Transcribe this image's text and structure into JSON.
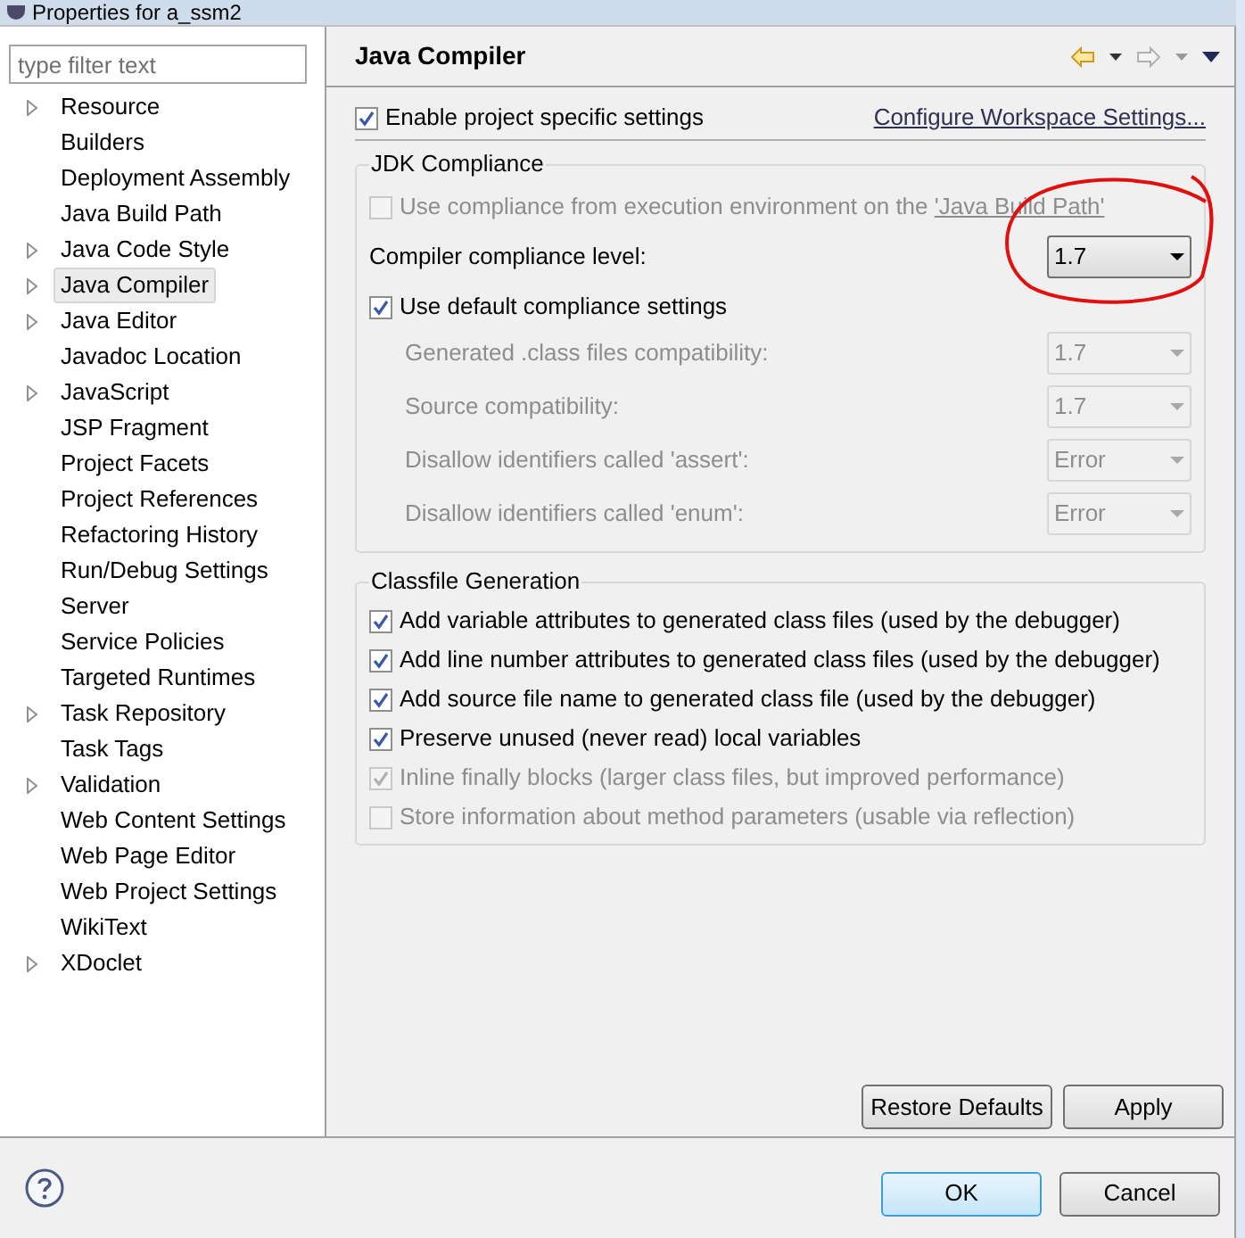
{
  "window": {
    "title": "Properties for a_ssm2"
  },
  "sidebar": {
    "filter": {
      "placeholder": "type filter text"
    },
    "items": [
      {
        "label": "Resource",
        "expandable": true,
        "selected": false
      },
      {
        "label": "Builders",
        "expandable": false,
        "selected": false
      },
      {
        "label": "Deployment Assembly",
        "expandable": false,
        "selected": false
      },
      {
        "label": "Java Build Path",
        "expandable": false,
        "selected": false
      },
      {
        "label": "Java Code Style",
        "expandable": true,
        "selected": false
      },
      {
        "label": "Java Compiler",
        "expandable": true,
        "selected": true
      },
      {
        "label": "Java Editor",
        "expandable": true,
        "selected": false
      },
      {
        "label": "Javadoc Location",
        "expandable": false,
        "selected": false
      },
      {
        "label": "JavaScript",
        "expandable": true,
        "selected": false
      },
      {
        "label": "JSP Fragment",
        "expandable": false,
        "selected": false
      },
      {
        "label": "Project Facets",
        "expandable": false,
        "selected": false
      },
      {
        "label": "Project References",
        "expandable": false,
        "selected": false
      },
      {
        "label": "Refactoring History",
        "expandable": false,
        "selected": false
      },
      {
        "label": "Run/Debug Settings",
        "expandable": false,
        "selected": false
      },
      {
        "label": "Server",
        "expandable": false,
        "selected": false
      },
      {
        "label": "Service Policies",
        "expandable": false,
        "selected": false
      },
      {
        "label": "Targeted Runtimes",
        "expandable": false,
        "selected": false
      },
      {
        "label": "Task Repository",
        "expandable": true,
        "selected": false
      },
      {
        "label": "Task Tags",
        "expandable": false,
        "selected": false
      },
      {
        "label": "Validation",
        "expandable": true,
        "selected": false
      },
      {
        "label": "Web Content Settings",
        "expandable": false,
        "selected": false
      },
      {
        "label": "Web Page Editor",
        "expandable": false,
        "selected": false
      },
      {
        "label": "Web Project Settings",
        "expandable": false,
        "selected": false
      },
      {
        "label": "WikiText",
        "expandable": false,
        "selected": false
      },
      {
        "label": "XDoclet",
        "expandable": true,
        "selected": false
      }
    ]
  },
  "page": {
    "title": "Java Compiler",
    "enable_specific": {
      "label": "Enable project specific settings",
      "checked": true
    },
    "configure_link": "Configure Workspace Settings...",
    "jdk_compliance": {
      "title": "JDK Compliance",
      "use_ee": {
        "label": "Use compliance from execution environment on the ",
        "link": "'Java Build Path'",
        "checked": false,
        "disabled": true
      },
      "compliance_level": {
        "label": "Compiler compliance level:",
        "value": "1.7"
      },
      "use_default": {
        "label": "Use default compliance settings",
        "checked": true
      },
      "settings": [
        {
          "label": "Generated .class files compatibility:",
          "value": "1.7",
          "disabled": true
        },
        {
          "label": "Source compatibility:",
          "value": "1.7",
          "disabled": true
        },
        {
          "label": "Disallow identifiers called 'assert':",
          "value": "Error",
          "disabled": true
        },
        {
          "label": "Disallow identifiers called 'enum':",
          "value": "Error",
          "disabled": true
        }
      ]
    },
    "classfile": {
      "title": "Classfile Generation",
      "options": [
        {
          "label": "Add variable attributes to generated class files (used by the debugger)",
          "checked": true,
          "disabled": false
        },
        {
          "label": "Add line number attributes to generated class files (used by the debugger)",
          "checked": true,
          "disabled": false
        },
        {
          "label": "Add source file name to generated class file (used by the debugger)",
          "checked": true,
          "disabled": false
        },
        {
          "label": "Preserve unused (never read) local variables",
          "checked": true,
          "disabled": false
        },
        {
          "label": "Inline finally blocks (larger class files, but improved performance)",
          "checked": true,
          "disabled": true
        },
        {
          "label": "Store information about method parameters (usable via reflection)",
          "checked": false,
          "disabled": true
        }
      ]
    },
    "page_buttons": [
      {
        "label": "Restore Defaults",
        "default": false
      },
      {
        "label": "Apply",
        "default": false
      }
    ]
  },
  "dialog_buttons": [
    {
      "label": "OK",
      "default": true
    },
    {
      "label": "Cancel",
      "default": false
    }
  ]
}
